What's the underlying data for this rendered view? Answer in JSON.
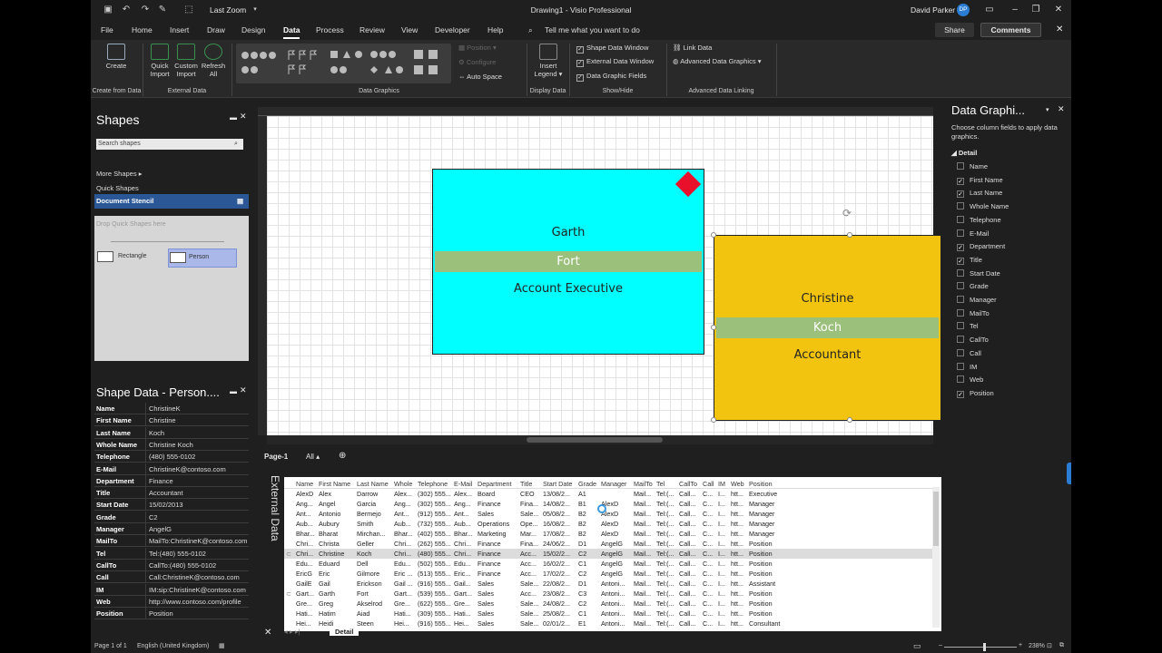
{
  "titlebar": {
    "autosave_label": "Last Zoom",
    "title": "Drawing1  -  Visio Professional",
    "user": "David Parker",
    "initials": "DP"
  },
  "menu": [
    "File",
    "Home",
    "Insert",
    "Draw",
    "Design",
    "Data",
    "Process",
    "Review",
    "View",
    "Developer",
    "Help"
  ],
  "tell_me": "Tell me what you want to do",
  "share": "Share",
  "comments": "Comments",
  "ribbon": {
    "create": "Create",
    "quick_import": [
      "Quick",
      "Import"
    ],
    "custom_import": [
      "Custom",
      "Import"
    ],
    "refresh_all": [
      "Refresh",
      "All"
    ],
    "position": "Position",
    "configure": "Configure",
    "auto_space": "Auto Space",
    "insert_legend": [
      "Insert",
      "Legend"
    ],
    "shape_data_window": "Shape Data Window",
    "external_data_window": "External Data Window",
    "data_graphic_fields": "Data Graphic Fields",
    "link_data": "Link Data",
    "advanced_data_graphics": "Advanced Data Graphics",
    "groups": [
      "Create from Data",
      "External Data",
      "Data Graphics",
      "Display Data",
      "Show/Hide",
      "Advanced Data Linking"
    ]
  },
  "shapes": {
    "title": "Shapes",
    "search_placeholder": "Search shapes",
    "more_shapes": "More Shapes",
    "quick_shapes": "Quick Shapes",
    "document_stencil": "Document Stencil",
    "drop_text": "Drop Quick Shapes here",
    "rectangle": "Rectangle",
    "person": "Person"
  },
  "shape_data": {
    "title": "Shape Data - Person....",
    "rows": [
      [
        "Name",
        "ChristineK"
      ],
      [
        "First Name",
        "Christine"
      ],
      [
        "Last Name",
        "Koch"
      ],
      [
        "Whole Name",
        "Christine Koch"
      ],
      [
        "Telephone",
        "(480) 555-0102"
      ],
      [
        "E-Mail",
        "ChristineK@contoso.com"
      ],
      [
        "Department",
        "Finance"
      ],
      [
        "Title",
        "Accountant"
      ],
      [
        "Start Date",
        "15/02/2013"
      ],
      [
        "Grade",
        "C2"
      ],
      [
        "Manager",
        "AngelG"
      ],
      [
        "MailTo",
        "MailTo:ChristineK@contoso.com"
      ],
      [
        "Tel",
        "Tel:(480) 555-0102"
      ],
      [
        "CallTo",
        "CallTo:(480) 555-0102"
      ],
      [
        "Call",
        "Call:ChristineK@contoso.com"
      ],
      [
        "IM",
        "IM:sip:ChristineK@contoso.com"
      ],
      [
        "Web",
        "http://www.contoso.com/profile"
      ],
      [
        "Position",
        "Position"
      ]
    ]
  },
  "canvas": {
    "shape1": {
      "first": "Garth",
      "last": "Fort",
      "title": "Account Executive",
      "fill": "#00ffff",
      "marker": "#e8102a"
    },
    "shape2": {
      "first": "Christine",
      "last": "Koch",
      "title": "Accountant",
      "fill": "#f2c40f"
    }
  },
  "page_tabs": {
    "page": "Page-1",
    "all": "All"
  },
  "data_graphics": {
    "title": "Data Graphi...",
    "hint": "Choose column fields to apply data graphics.",
    "section": "Detail",
    "fields": [
      [
        "Name",
        false
      ],
      [
        "First Name",
        true
      ],
      [
        "Last Name",
        true
      ],
      [
        "Whole Name",
        false
      ],
      [
        "Telephone",
        false
      ],
      [
        "E-Mail",
        false
      ],
      [
        "Department",
        true
      ],
      [
        "Title",
        true
      ],
      [
        "Start Date",
        false
      ],
      [
        "Grade",
        false
      ],
      [
        "Manager",
        false
      ],
      [
        "MailTo",
        false
      ],
      [
        "Tel",
        false
      ],
      [
        "CallTo",
        false
      ],
      [
        "Call",
        false
      ],
      [
        "IM",
        false
      ],
      [
        "Web",
        false
      ],
      [
        "Position",
        true
      ]
    ]
  },
  "external_data": {
    "label": "External Data",
    "tab": "Detail",
    "headers": [
      "Name",
      "First Name",
      "Last Name",
      "Whole",
      "Telephone",
      "E-Mail",
      "Department",
      "Title",
      "Start Date",
      "Grade",
      "Manager",
      "MailTo",
      "Tel",
      "CallTo",
      "Call",
      "IM",
      "Web",
      "Position"
    ],
    "rows": [
      [
        "AlexD",
        "Alex",
        "Darrow",
        "Alex...",
        "(302) 555...",
        "Alex...",
        "Board",
        "CEO",
        "13/08/2...",
        "A1",
        "",
        "Mail...",
        "Tel:(...",
        "Call...",
        "C...",
        "I...",
        "htt...",
        "Executive"
      ],
      [
        "Ang...",
        "Angel",
        "Garcia",
        "Ang...",
        "(302) 555...",
        "Ang...",
        "Finance",
        "Fina...",
        "14/08/2...",
        "B1",
        "AlexD",
        "Mail...",
        "Tel:(...",
        "Call...",
        "C...",
        "I...",
        "htt...",
        "Manager"
      ],
      [
        "Ant...",
        "Antonio",
        "Bermejo",
        "Ant...",
        "(912) 555...",
        "Ant...",
        "Sales",
        "Sale...",
        "05/08/2...",
        "B2",
        "AlexD",
        "Mail...",
        "Tel:(...",
        "Call...",
        "C...",
        "I...",
        "htt...",
        "Manager"
      ],
      [
        "Aub...",
        "Aubury",
        "Smith",
        "Aub...",
        "(732) 555...",
        "Aub...",
        "Operations",
        "Ope...",
        "16/08/2...",
        "B2",
        "AlexD",
        "Mail...",
        "Tel:(...",
        "Call...",
        "C...",
        "I...",
        "htt...",
        "Manager"
      ],
      [
        "Bhar...",
        "Bharat",
        "Mirchan...",
        "Bhar...",
        "(402) 555...",
        "Bhar...",
        "Marketing",
        "Mar...",
        "17/08/2...",
        "B2",
        "AlexD",
        "Mail...",
        "Tel:(...",
        "Call...",
        "C...",
        "I...",
        "htt...",
        "Manager"
      ],
      [
        "Chri...",
        "Christa",
        "Geller",
        "Chri...",
        "(262) 555...",
        "Chri...",
        "Finance",
        "Fina...",
        "24/06/2...",
        "D1",
        "AngelG",
        "Mail...",
        "Tel:(...",
        "Call...",
        "C...",
        "I...",
        "htt...",
        "Position"
      ],
      [
        "Chri...",
        "Christine",
        "Koch",
        "Chri...",
        "(480) 555...",
        "Chri...",
        "Finance",
        "Acc...",
        "15/02/2...",
        "C2",
        "AngelG",
        "Mail...",
        "Tel:(...",
        "Call...",
        "C...",
        "I...",
        "htt...",
        "Position"
      ],
      [
        "Edu...",
        "Eduard",
        "Dell",
        "Edu...",
        "(502) 555...",
        "Edu...",
        "Finance",
        "Acc...",
        "16/02/2...",
        "C1",
        "AngelG",
        "Mail...",
        "Tel:(...",
        "Call...",
        "C...",
        "I...",
        "htt...",
        "Position"
      ],
      [
        "EricG",
        "Eric",
        "Gilmore",
        "Eric ...",
        "(513) 555...",
        "Eric...",
        "Finance",
        "Acc...",
        "17/02/2...",
        "C2",
        "AngelG",
        "Mail...",
        "Tel:(...",
        "Call...",
        "C...",
        "I...",
        "htt...",
        "Position"
      ],
      [
        "GailE",
        "Gail",
        "Erickson",
        "Gail ...",
        "(916) 555...",
        "Gail...",
        "Sales",
        "Sale...",
        "22/08/2...",
        "D1",
        "Antoni...",
        "Mail...",
        "Tel:(...",
        "Call...",
        "C...",
        "I...",
        "htt...",
        "Assistant"
      ],
      [
        "Gart...",
        "Garth",
        "Fort",
        "Gart...",
        "(539) 555...",
        "Gart...",
        "Sales",
        "Acc...",
        "23/08/2...",
        "C3",
        "Antoni...",
        "Mail...",
        "Tel:(...",
        "Call...",
        "C...",
        "I...",
        "htt...",
        "Position"
      ],
      [
        "Gre...",
        "Greg",
        "Akselrod",
        "Gre...",
        "(622) 555...",
        "Gre...",
        "Sales",
        "Sale...",
        "24/08/2...",
        "C2",
        "Antoni...",
        "Mail...",
        "Tel:(...",
        "Call...",
        "C...",
        "I...",
        "htt...",
        "Position"
      ],
      [
        "Hati...",
        "Hatim",
        "Aiad",
        "Hati...",
        "(309) 555...",
        "Hati...",
        "Sales",
        "Sale...",
        "25/08/2...",
        "C1",
        "Antoni...",
        "Mail...",
        "Tel:(...",
        "Call...",
        "C...",
        "I...",
        "htt...",
        "Position"
      ],
      [
        "Hei...",
        "Heidi",
        "Steen",
        "Hei...",
        "(916) 555...",
        "Hei...",
        "Sales",
        "Sale...",
        "02/01/2...",
        "E1",
        "Antoni...",
        "Mail...",
        "Tel:(...",
        "Call...",
        "C...",
        "I...",
        "htt...",
        "Consultant"
      ]
    ]
  },
  "status": {
    "page": "Page 1 of 1",
    "language": "English (United Kingdom)",
    "zoom": "238%"
  }
}
